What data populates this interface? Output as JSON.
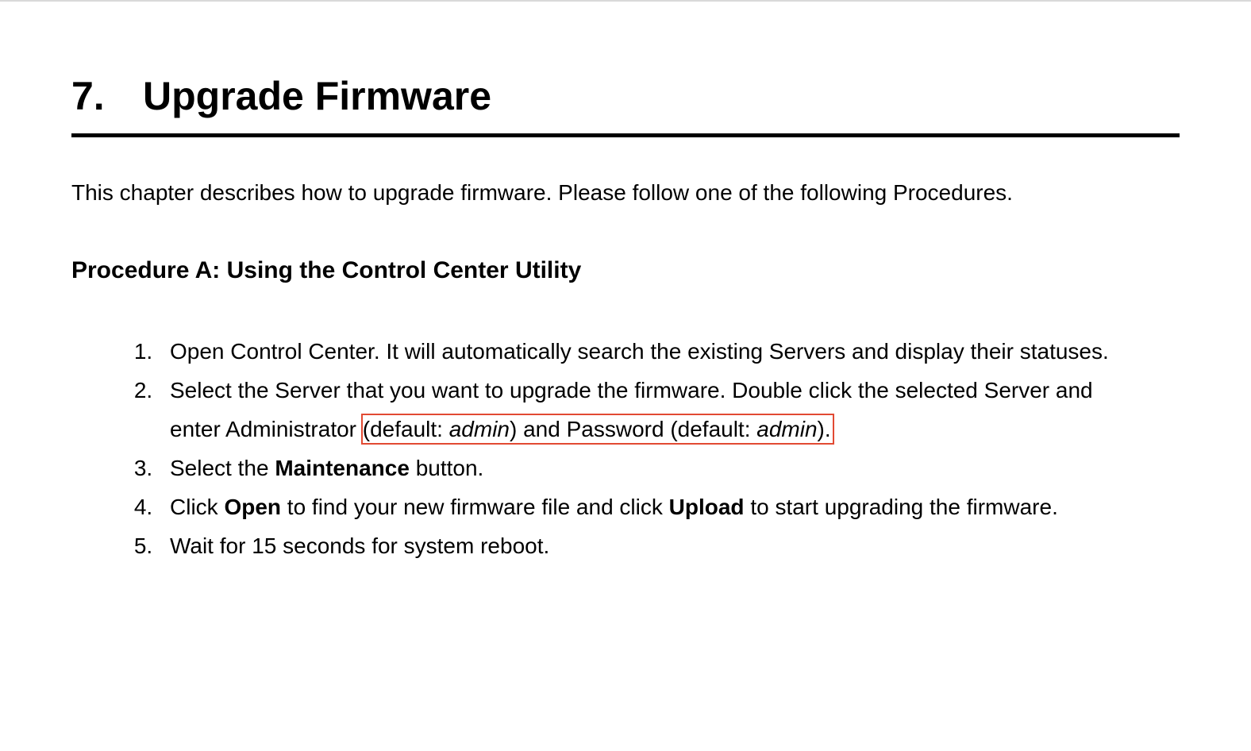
{
  "chapter": {
    "number": "7.",
    "title": "Upgrade Firmware"
  },
  "intro": "This chapter describes how to upgrade firmware. Please follow one of the following Procedures.",
  "procedure_a": {
    "heading": "Procedure A: Using the Control Center Utility",
    "steps": {
      "s1": "Open Control Center. It will automatically search the existing Servers and display their statuses.",
      "s2_a": "Select the Server that you want to upgrade the firmware. Double click the selected Server and enter Administrator ",
      "s2_highlight_a": "(default: ",
      "s2_highlight_b": "admin",
      "s2_highlight_c": ") and Password (default: ",
      "s2_highlight_d": "admin",
      "s2_highlight_e": ").",
      "s3_a": "Select the ",
      "s3_b": "Maintenance",
      "s3_c": " button.",
      "s4_a": "Click ",
      "s4_b": "Open",
      "s4_c": " to find your new firmware file and click ",
      "s4_d": "Upload",
      "s4_e": " to start upgrading the firmware.",
      "s5": "Wait for 15 seconds for system reboot."
    }
  }
}
